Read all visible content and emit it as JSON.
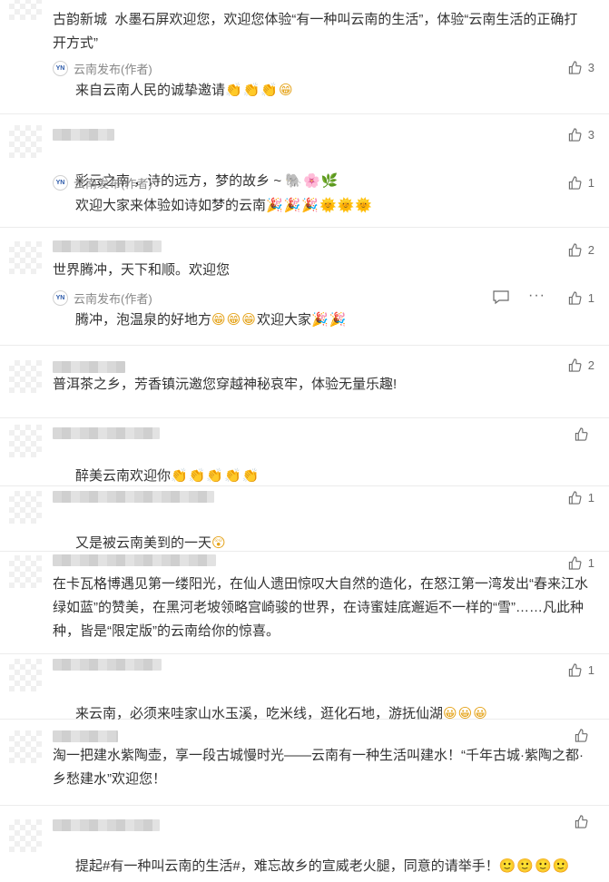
{
  "colors": {
    "text": "#333333",
    "author": "#888888",
    "icon": "#6b6b6b",
    "emoji": "#e5a41c",
    "divider": "#ececec"
  },
  "icons": {
    "like": "thumbs-up-icon",
    "reply": "comment-bubble-icon",
    "more": "more-dots-icon",
    "avatar": "blurred-avatar",
    "logo": "yunnan-logo"
  },
  "author_label": "云南发布(作者)",
  "comments": [
    {
      "text": "古韵新城  水墨石屏欢迎您，欢迎您体验“有一种叫云南的生活”，体验“云南生活的正确打开方式”",
      "likes": "",
      "reply": {
        "author": "云南发布(作者)",
        "text": "来自云南人民的诚挚邀请",
        "emoji": "👏👏👏😁",
        "likes": "3"
      }
    },
    {
      "text": "彩云之南 ，诗的远方，梦的故乡 ~ ",
      "emoji": "🐘🌸🌿",
      "likes": "3",
      "reply": {
        "author": "云南发布(作者)",
        "text": "欢迎大家来体验如诗如梦的云南",
        "emoji": "🎉🎉🎉🌞🌞🌞",
        "likes": "1"
      }
    },
    {
      "text": "世界腾冲，天下和顺。欢迎您",
      "likes": "2",
      "reply": {
        "author": "云南发布(作者)",
        "text": "腾冲，泡温泉的好地方",
        "emoji_mid": "😁😁😁",
        "text2": "欢迎大家",
        "emoji": "🎉🎉",
        "likes": "1"
      }
    },
    {
      "text": "普洱茶之乡，芳香镇沅邀您穿越神秘哀牢，体验无量乐趣!",
      "likes": "2"
    },
    {
      "text": "醉美云南欢迎你",
      "emoji": "👏👏👏👏👏",
      "likes": ""
    },
    {
      "text": "又是被云南美到的一天",
      "emoji": "😲",
      "likes": "1"
    },
    {
      "text": "在卡瓦格博遇见第一缕阳光，在仙人遗田惊叹大自然的造化，在怒江第一湾发出“春来江水绿如蓝”的赞美，在黑河老坡领略宫崎骏的世界，在诗蜜娃底邂逅不一样的“雪”……凡此种种，皆是“限定版”的云南给你的惊喜。",
      "likes": "1"
    },
    {
      "text": "来云南，必须来哇家山水玉溪，吃米线，逛化石地，游抚仙湖",
      "emoji": "😀😀😀",
      "likes": "1"
    },
    {
      "text": "淘一把建水紫陶壶，享一段古城慢时光——云南有一种生活叫建水！“千年古城·紫陶之都·乡愁建水”欢迎您！",
      "likes": ""
    },
    {
      "text": "提起#有一种叫云南的生活#，难忘故乡的宣威老火腿，同意的请举手！",
      "emoji": "🙂🙂🙂🙂",
      "likes": ""
    }
  ]
}
